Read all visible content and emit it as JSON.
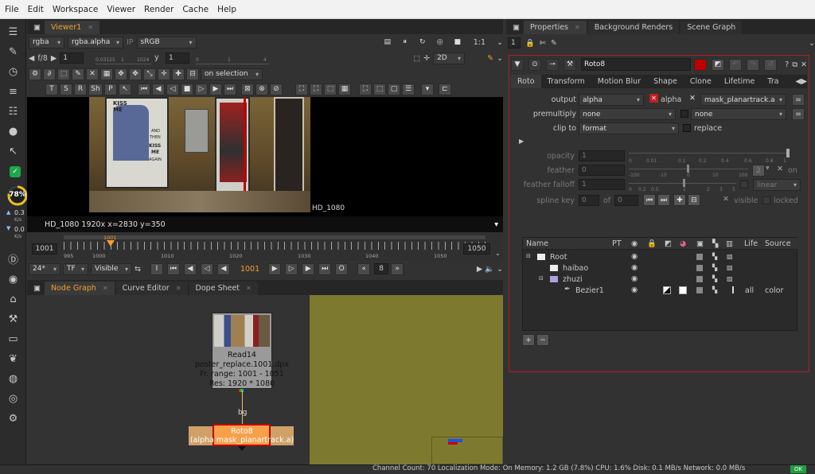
{
  "menu": [
    "File",
    "Edit",
    "Workspace",
    "Viewer",
    "Render",
    "Cache",
    "Help"
  ],
  "left_toolbar": {
    "cpu_percent": "78%",
    "net_up": "0.3",
    "net_up_unit": "K/s",
    "net_down": "0.0",
    "net_down_unit": "K/s",
    "cpu_value": 0.78
  },
  "viewer": {
    "tab": "Viewer1",
    "channels": "rgba",
    "alpha": "rgba.alpha",
    "ip": "IP",
    "colorspace": "sRGB",
    "fstop": "f/8",
    "gain": "1",
    "gamma_label": "y",
    "gamma": "1",
    "ratio": "1:1",
    "mode": "2D",
    "gain_ticks": [
      "0.03125",
      "1",
      "1024"
    ],
    "gamma_ticks": [
      "0",
      "1",
      "4"
    ],
    "on_selection": "on selection",
    "tool_letters": [
      "T",
      "S",
      "R",
      "Sh",
      "P"
    ],
    "format_label": "HD_1080",
    "info": "HD_1080 1920x  x=2830 y=350",
    "poster_text": [
      "KISS",
      "ME",
      "AND",
      "THEN",
      "KISS",
      "ME",
      "AGAIN"
    ]
  },
  "timeline": {
    "start": "1001",
    "end": "1050",
    "current": "1001",
    "ticks": [
      "995",
      "1000",
      "1010",
      "1020",
      "1030",
      "1040",
      "1050"
    ],
    "fps": "24*",
    "tf": "TF",
    "visible": "Visible",
    "step": "8"
  },
  "nodegraph": {
    "tabs": [
      "Node Graph",
      "Curve Editor",
      "Dope Sheet"
    ],
    "read_node": {
      "name": "Read14",
      "file": "poster_replace.1001.dpx",
      "range": "Fr. range: 1001 - 1051",
      "res": "Res: 1920 * 1080"
    },
    "bg_label": "bg",
    "roto_node": {
      "name": "Roto8",
      "sub": "(alpha mask_planartrack.a)"
    }
  },
  "properties": {
    "tabs": [
      "Properties",
      "Background Renders",
      "Scene Graph"
    ],
    "count": "1",
    "node_name": "Roto8",
    "subtabs": [
      "Roto",
      "Transform",
      "Motion Blur",
      "Shape",
      "Clone",
      "Lifetime",
      "Tra"
    ],
    "output_label": "output",
    "output_value": "alpha",
    "alpha_label": "alpha",
    "mask_value": "mask_planartrack.a",
    "premult_label": "premultiply",
    "premult_value": "none",
    "premult_value2": "none",
    "clip_label": "clip to",
    "clip_value": "format",
    "replace_label": "replace",
    "opacity_label": "opacity",
    "opacity_value": "1",
    "opacity_ticks": [
      "0",
      "0.01",
      "0.1",
      "0.2",
      "0.4",
      "0.6",
      "0.8",
      "1"
    ],
    "feather_label": "feather",
    "feather_value": "0",
    "feather_ticks": [
      "-100",
      "-10",
      "0",
      "10",
      "100"
    ],
    "feather_on": "on",
    "ff_label": "feather falloff",
    "ff_value": "1",
    "ff_ticks": [
      "0",
      "0.2",
      "0.5",
      "1",
      "2",
      "3",
      "5"
    ],
    "ff_mode": "linear",
    "spline_label": "spline key",
    "spline_value": "0",
    "spline_of": "of",
    "spline_total": "0",
    "visible_label": "visible",
    "locked_label": "locked",
    "tree_headers": [
      "Name",
      "PT",
      "Life",
      "Source"
    ],
    "tree": [
      {
        "name": "Root",
        "life": "",
        "source": ""
      },
      {
        "name": "haibao",
        "life": "",
        "source": ""
      },
      {
        "name": "zhuzi",
        "life": "",
        "source": ""
      },
      {
        "name": "Bezier1",
        "life": "all",
        "source": "color"
      }
    ]
  },
  "status": {
    "text": "Channel Count: 70  Localization Mode: On  Memory: 1.2 GB (7.8%)  CPU: 1.6%  Disk: 0.1 MB/s  Network: 0.0 MB/s",
    "ok": "OK"
  },
  "colors": {
    "accent": "#f0a030",
    "node_orange": "#f6a04a",
    "roto_red": "#c00000",
    "read_node": "#9a9a9a",
    "panel_border": "#b02020",
    "olive": "#7d7a2f"
  }
}
